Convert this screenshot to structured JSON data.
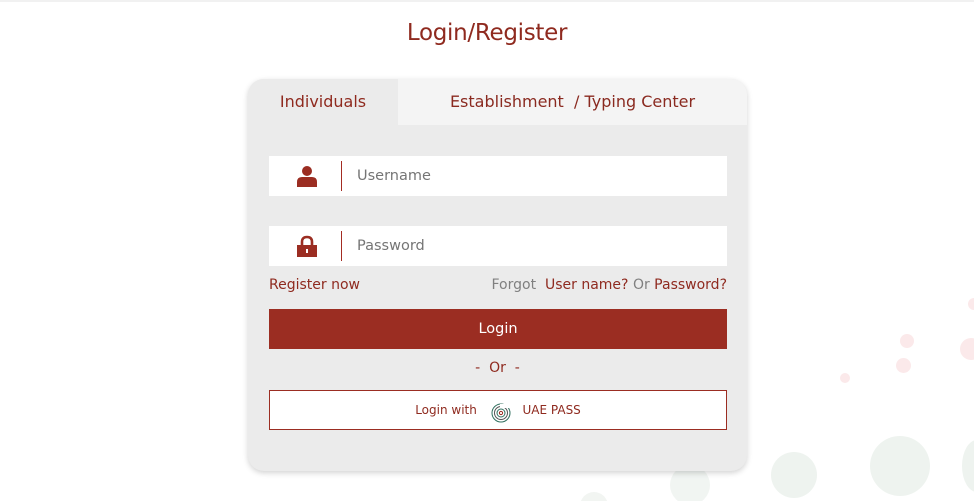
{
  "page": {
    "title": "Login/Register"
  },
  "tabs": [
    {
      "label": "Individuals",
      "active": true
    },
    {
      "label": "Establishment  / Typing Center",
      "active": false
    }
  ],
  "form": {
    "username_placeholder": "Username",
    "password_placeholder": "Password",
    "register_label": "Register now",
    "forgot_label": "Forgot",
    "username_link": "User name?",
    "or_word": "Or",
    "password_link": "Password?",
    "login_label": "Login",
    "separator": "-  Or  -",
    "uaepass_prefix": "Login with",
    "uaepass_label": "UAE PASS"
  },
  "icons": {
    "username": "user-icon",
    "password": "lock-icon",
    "uaepass": "fingerprint-icon"
  },
  "colors": {
    "brand": "#9b2d22",
    "card_bg": "#ebebeb",
    "muted_text": "#808080"
  }
}
